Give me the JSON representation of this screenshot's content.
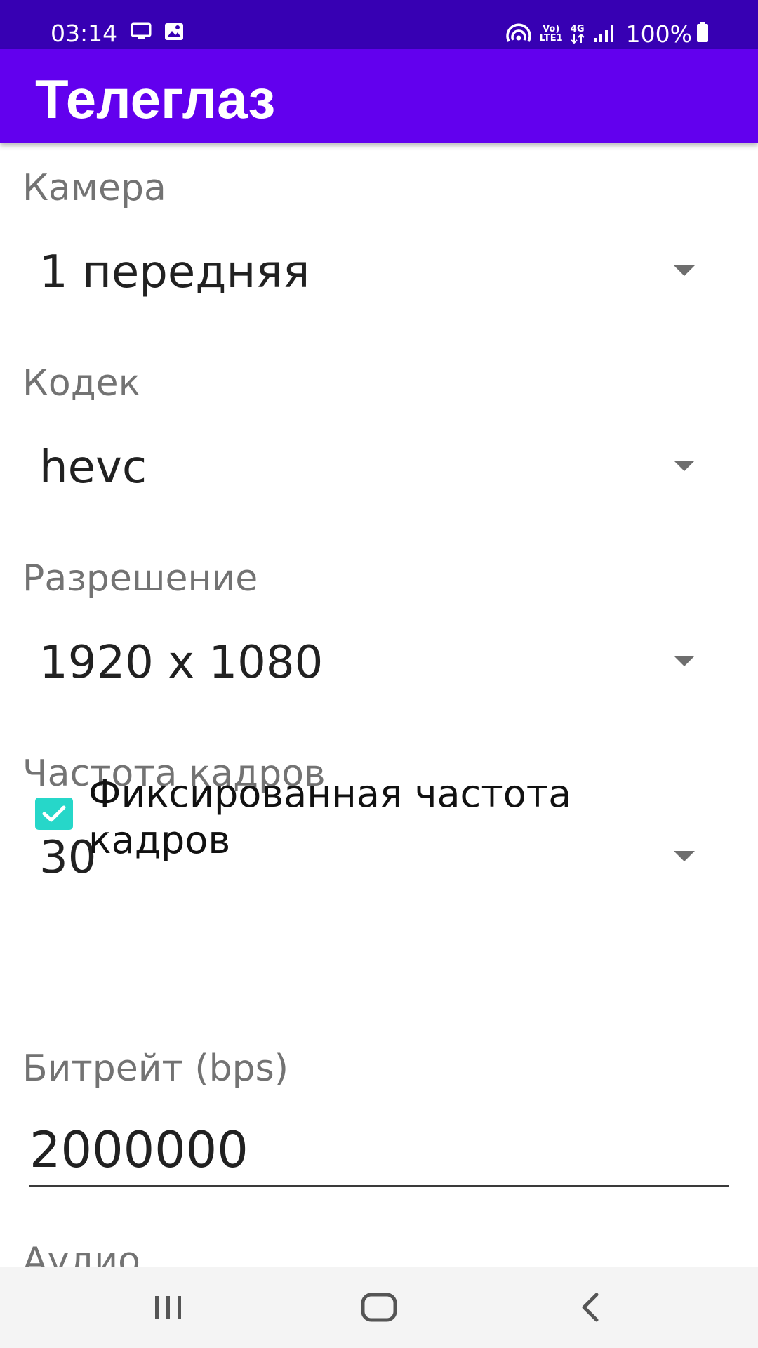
{
  "status_bar": {
    "time": "03:14",
    "battery_percent": "100%",
    "lte_top": "Vo)",
    "lte_bottom": "LTE1",
    "net_type": "4G"
  },
  "app_bar": {
    "title": "Телеглаз"
  },
  "settings": {
    "camera": {
      "label": "Камера",
      "value": "1 передняя"
    },
    "codec": {
      "label": "Кодек",
      "value": "hevc"
    },
    "resolution": {
      "label": "Разрешение",
      "value": "1920 x 1080"
    },
    "framerate": {
      "label": "Частота кадров",
      "value": "30"
    },
    "fixed_framerate": {
      "label": "Фиксированная частота кадров",
      "checked": true
    },
    "bitrate": {
      "label": "Битрейт (bps)",
      "value": "2000000"
    },
    "audio": {
      "label": "Аудио"
    }
  },
  "nav_bar": {
    "recents": "recents-icon",
    "home": "home-icon",
    "back": "back-icon"
  },
  "colors": {
    "status_bar": "#3700b3",
    "app_bar": "#6200ee",
    "checkbox": "#26d7c9",
    "label": "#737373",
    "nav_bar": "#f4f4f4"
  }
}
